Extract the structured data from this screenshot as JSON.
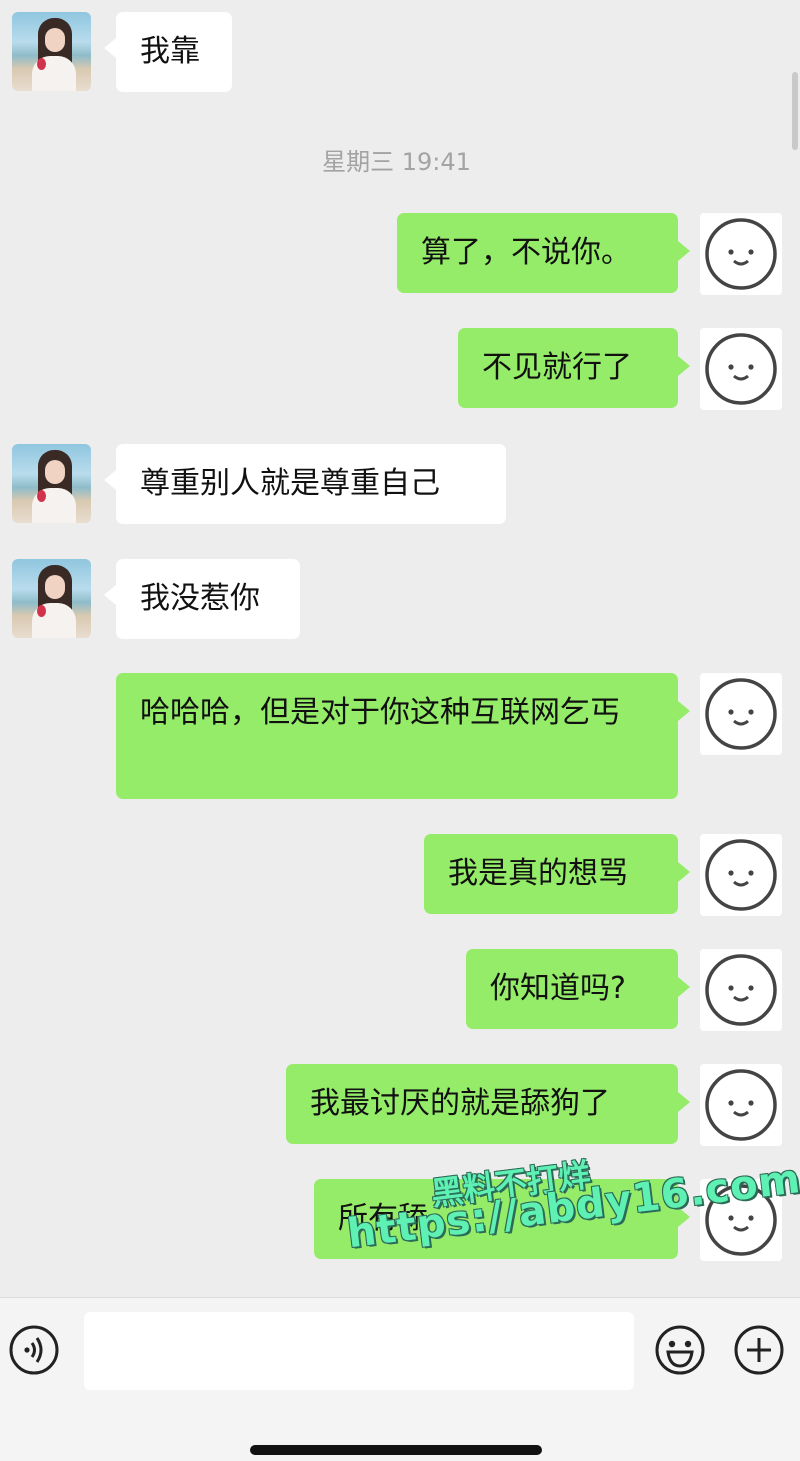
{
  "timestamp": "星期三 19:41",
  "messages": [
    {
      "side": "left",
      "text": "我靠"
    },
    {
      "side": "right",
      "text": "算了，不说你。"
    },
    {
      "side": "right",
      "text": "不见就行了"
    },
    {
      "side": "left",
      "text": "尊重别人就是尊重自己"
    },
    {
      "side": "left",
      "text": "我没惹你"
    },
    {
      "side": "right",
      "text": "哈哈哈，但是对于你这种互联网乞丐"
    },
    {
      "side": "right",
      "text": "我是真的想骂"
    },
    {
      "side": "right",
      "text": "你知道吗?"
    },
    {
      "side": "right",
      "text": "我最讨厌的就是舔狗了"
    },
    {
      "side": "right",
      "text": "所有舔"
    }
  ],
  "watermark": {
    "line1": "黑料不打烊",
    "line2": "https://abdy16.com"
  },
  "input": {
    "placeholder": "",
    "value": ""
  },
  "icons": {
    "voice": "voice-icon",
    "emoji": "emoji-icon",
    "plus": "plus-icon"
  },
  "colors": {
    "sent_bubble": "#95ec69",
    "received_bubble": "#ffffff",
    "background": "#ededed"
  }
}
